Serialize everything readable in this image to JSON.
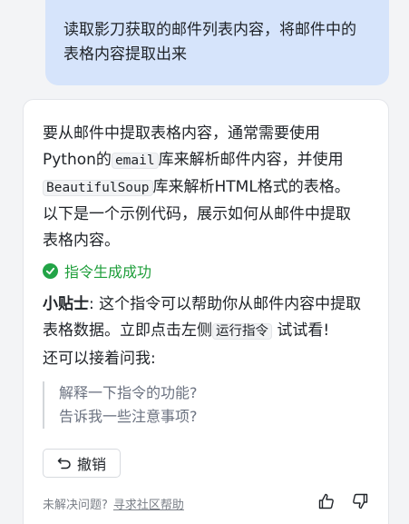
{
  "user_message": "读取影刀获取的邮件列表内容，将邮件中的表格内容提取出来",
  "answer": {
    "line1": "要从邮件中提取表格内容，通常需要使用",
    "python_prefix": "Python的",
    "code_email": "email",
    "after_email": "库来解析邮件内容，并使用",
    "code_bs": "BeautifulSoup",
    "after_bs": "库来解析HTML格式的表格。",
    "line4": "以下是一个示例代码，展示如何从邮件中提取",
    "line5": "表格内容。"
  },
  "success_text": "指令生成成功",
  "tip": {
    "label": "小贴士",
    "text1": ": 这个指令可以帮助你从邮件内容中提取",
    "text2": "表格数据。立即点击左侧",
    "code": "运行指令",
    "text3": " 试试看!"
  },
  "ask_label": "还可以接着问我:",
  "suggestions": [
    "解释一下指令的功能?",
    "告诉我一些注意事项?"
  ],
  "undo_label": "撤销",
  "footer": {
    "question": "未解决问题?",
    "link": "寻求社区帮助"
  },
  "icons": {
    "success": "check-circle-icon",
    "undo": "undo-icon",
    "like": "thumb-up-icon",
    "dislike": "thumb-down-icon"
  },
  "colors": {
    "user_bubble": "#d6e4fb",
    "success": "#22a447",
    "muted": "#6b7280"
  }
}
